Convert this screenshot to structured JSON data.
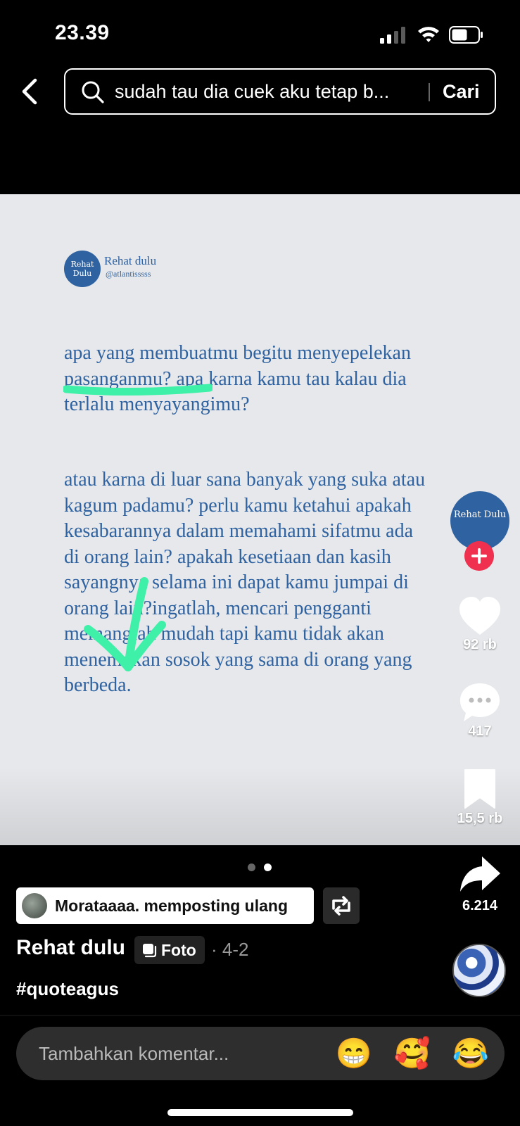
{
  "status_bar": {
    "time": "23.39"
  },
  "search": {
    "query": "sudah tau dia cuek aku tetap b...",
    "submit_label": "Cari"
  },
  "post_image": {
    "logo_text": "Rehat Dulu",
    "account_name": "Rehat dulu",
    "account_handle": "@atlantisssss",
    "quote_paragraph_1": "apa yang membuatmu begitu menyepelekan pasanganmu? apa karna kamu tau kalau dia terlalu menyayangimu?",
    "quote_paragraph_2": "atau karna di luar sana banyak yang suka atau kagum padamu? perlu kamu ketahui apakah kesabarannya dalam memahami sifatmu ada di orang lain? apakah kesetiaan dan kasih sayangnya selama ini dapat kamu jumpai di orang lain?ingatlah, mencari pengganti memanglah mudah tapi kamu tidak akan menemukan sosok yang sama di orang yang berbeda."
  },
  "actions": {
    "creator_avatar_text": "Rehat Dulu",
    "likes": "92 rb",
    "comments": "417",
    "saves": "15,5 rb",
    "shares": "6.214"
  },
  "pager": {
    "count": 2,
    "active": 2
  },
  "repost": {
    "text": "Morataaaa. memposting ulang"
  },
  "caption": {
    "author": "Rehat dulu",
    "type_badge": "Foto",
    "date": "· 4-2",
    "hashtag": "#quoteagus"
  },
  "comment_bar": {
    "placeholder": "Tambahkan komentar...",
    "emojis": [
      "😁",
      "🥰",
      "😂"
    ]
  },
  "colors": {
    "accent_green": "#3ef0a8",
    "follow_red": "#f0304f",
    "quote_blue": "#2f62a0"
  }
}
